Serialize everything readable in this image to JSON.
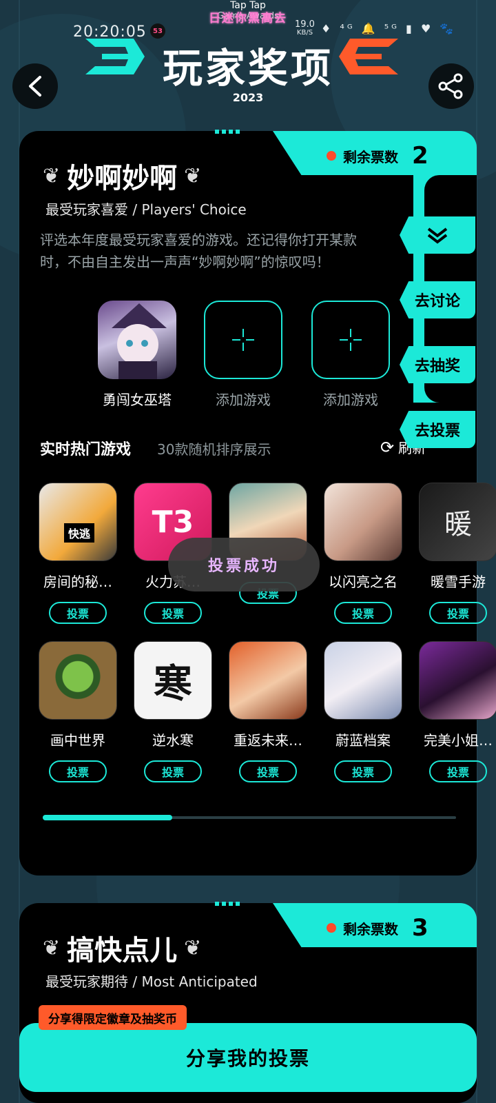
{
  "status_bar": {
    "time": "20:20:05",
    "badge": "53",
    "net_speed": "19.0",
    "net_unit": "KB/S",
    "icons": "♦ ⁴ᴳ 🔔 ⁵ᴳ ▮ ♥ 🐾"
  },
  "overlay": {
    "top_text": "Tap Tap",
    "sub_text": "Game Awards",
    "pink_text": "日迷你黑高去"
  },
  "header": {
    "title": "玩家奖项",
    "year": "2023"
  },
  "card1": {
    "votes_label": "剩余票数",
    "votes_count": "2",
    "title": "妙啊妙啊",
    "subtitle": "最受玩家喜爱 / Players' Choice",
    "desc_line1": "评选本年度最受玩家喜爱的游戏。还记得你打开某款",
    "desc_line2": "时，不由自主发出一声声“妙啊妙啊”的惊叹吗！",
    "slots": [
      {
        "label": "勇闯女巫塔"
      },
      {
        "label": "添加游戏"
      },
      {
        "label": "添加游戏"
      }
    ],
    "hot_title": "实时热门游戏",
    "hot_hint": "30款随机排序展示",
    "refresh_label": "刷新",
    "vote_btn": "投票",
    "games_row1": [
      {
        "name": "房间的秘…"
      },
      {
        "name": "火力苏…"
      },
      {
        "name": ""
      },
      {
        "name": "以闪亮之名"
      },
      {
        "name": "暖雪手游"
      }
    ],
    "games_row2": [
      {
        "name": "画中世界"
      },
      {
        "name": "逆水寒"
      },
      {
        "name": "重返未来…"
      },
      {
        "name": "蔚蓝档案"
      },
      {
        "name": "完美小姐…"
      }
    ]
  },
  "side_buttons": {
    "discuss": "去讨论",
    "lottery": "去抽奖",
    "vote": "去投票"
  },
  "toast": "投票成功",
  "card2": {
    "votes_label": "剩余票数",
    "votes_count": "3",
    "title": "搞快点儿",
    "subtitle": "最受玩家期待 / Most Anticipated"
  },
  "share": {
    "tag": "分享得限定徽章及抽奖币",
    "button": "分享我的投票"
  },
  "colors": {
    "accent": "#1ce9d8",
    "alert": "#ff4a2a",
    "card": "#000000",
    "background": "#1b3744"
  }
}
